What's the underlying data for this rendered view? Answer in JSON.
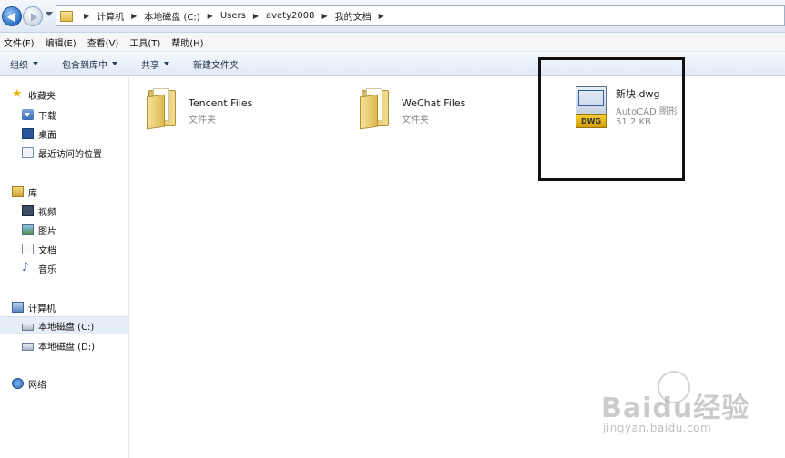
{
  "address_bar": {
    "breadcrumbs": [
      "计算机",
      "本地磁盘 (C:)",
      "Users",
      "avety2008",
      "我的文档"
    ]
  },
  "menu": [
    "文件(F)",
    "编辑(E)",
    "查看(V)",
    "工具(T)",
    "帮助(H)"
  ],
  "toolbar": {
    "organize": "组织",
    "include_library": "包含到库中",
    "share": "共享",
    "new_folder": "新建文件夹"
  },
  "sidebar": {
    "favorites": {
      "label": "收藏夹",
      "items": [
        "下载",
        "桌面",
        "最近访问的位置"
      ]
    },
    "libraries": {
      "label": "库",
      "items": [
        "视频",
        "图片",
        "文档",
        "音乐"
      ]
    },
    "computer": {
      "label": "计算机",
      "items": [
        "本地磁盘 (C:)",
        "本地磁盘 (D:)"
      ],
      "selected": "本地磁盘 (C:)"
    },
    "network": {
      "label": "网络"
    }
  },
  "files": [
    {
      "name": "Tencent Files",
      "type": "文件夹",
      "icon": "folder-icon"
    },
    {
      "name": "WeChat Files",
      "type": "文件夹",
      "icon": "folder-icon"
    },
    {
      "name": "新块.dwg",
      "type": "AutoCAD 图形",
      "size": "51.2 KB",
      "icon": "dwg-file-icon",
      "badge": "DWG"
    }
  ],
  "watermark": {
    "logo": "Baidu经验",
    "url": "jingyan.baidu.com"
  }
}
